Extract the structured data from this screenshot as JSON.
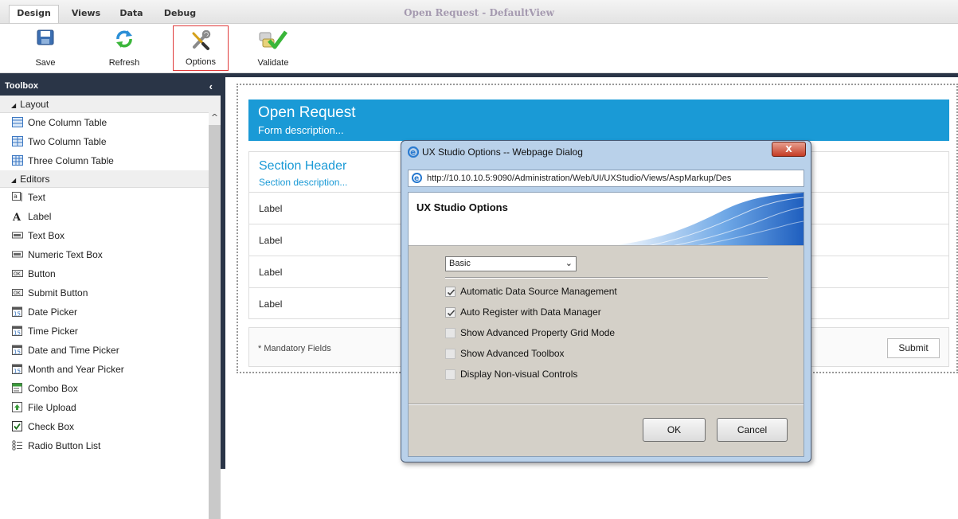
{
  "window": {
    "title": "Open Request - DefaultView"
  },
  "tabs": [
    {
      "label": "Design"
    },
    {
      "label": "Views"
    },
    {
      "label": "Data"
    },
    {
      "label": "Debug"
    }
  ],
  "ribbon": {
    "save": "Save",
    "refresh": "Refresh",
    "options": "Options",
    "validate": "Validate"
  },
  "toolbox": {
    "title": "Toolbox",
    "collapse": "‹",
    "scroll_up": "^",
    "layout": {
      "label": "Layout",
      "items": [
        "One Column Table",
        "Two Column Table",
        "Three Column Table"
      ]
    },
    "editors": {
      "label": "Editors",
      "items": [
        "Text",
        "Label",
        "Text Box",
        "Numeric Text Box",
        "Button",
        "Submit Button",
        "Date Picker",
        "Time Picker",
        "Date and Time Picker",
        "Month and Year Picker",
        "Combo Box",
        "File Upload",
        "Check Box",
        "Radio Button List"
      ]
    }
  },
  "form": {
    "title": "Open Request",
    "description": "Form description...",
    "section_header": "Section Header",
    "section_description": "Section description...",
    "rows": [
      "Label",
      "Label",
      "Label",
      "Label"
    ],
    "mandatory": "* Mandatory Fields",
    "submit": "Submit"
  },
  "dialog": {
    "caption": "UX Studio Options -- Webpage Dialog",
    "close": "X",
    "url_host": "http://10.10.10.5",
    "url_rest": ":9090/Administration/Web/UI/UXStudio/Views/AspMarkup/Des",
    "heading": "UX Studio Options",
    "mode": "Basic",
    "options": [
      {
        "label": "Automatic Data Source Management",
        "checked": true,
        "enabled": true
      },
      {
        "label": "Auto Register with Data Manager",
        "checked": true,
        "enabled": true
      },
      {
        "label": "Show Advanced Property Grid Mode",
        "checked": false,
        "enabled": false
      },
      {
        "label": "Show Advanced Toolbox",
        "checked": false,
        "enabled": false
      },
      {
        "label": "Display Non-visual Controls",
        "checked": false,
        "enabled": false
      }
    ],
    "ok": "OK",
    "cancel": "Cancel"
  },
  "colors": {
    "accent": "#1a9ad6",
    "dark_bar": "#2a3547",
    "validate_green": "#3ab63a"
  }
}
